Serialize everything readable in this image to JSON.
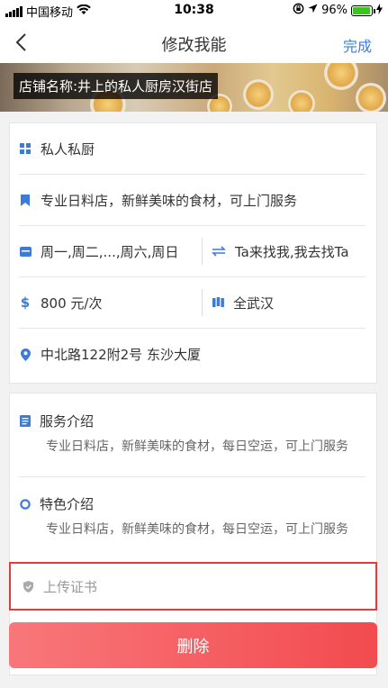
{
  "status_bar": {
    "carrier": "中国移动",
    "time": "10:38",
    "battery": "96%",
    "battery_level": 0.96,
    "icons": [
      "signal-icon",
      "wifi-icon",
      "lock-rotation-icon",
      "location-icon",
      "battery-icon",
      "charging-icon"
    ]
  },
  "nav": {
    "title": "修改我能",
    "done_label": "完成",
    "back_icon": "chevron-left-icon"
  },
  "banner": {
    "store_name": "店铺名称:井上的私人厨房汉街店"
  },
  "details": {
    "category": "私人私厨",
    "tagline": "专业日料店，新鲜美味的食材，可上门服务",
    "schedule": "周一,周二,...,周六,周日",
    "service_mode": "Ta来找我,我去找Ta",
    "price": "800 元/次",
    "area": "全武汉",
    "address": "中北路122附2号 东沙大厦"
  },
  "service_intro": {
    "title": "服务介绍",
    "body": "专业日料店，新鲜美味的食材，每日空运，可上门服务"
  },
  "feature_intro": {
    "title": "特色介绍",
    "body": "专业日料店，新鲜美味的食材，每日空运，可上门服务"
  },
  "upload": {
    "label": "上传证书"
  },
  "delete_label": "删除",
  "colors": {
    "accent_blue": "#3a7fdc",
    "delete_red": "#f24b4f",
    "highlight_border": "#e23c3c",
    "icon_blue": "#3d7bd8"
  }
}
